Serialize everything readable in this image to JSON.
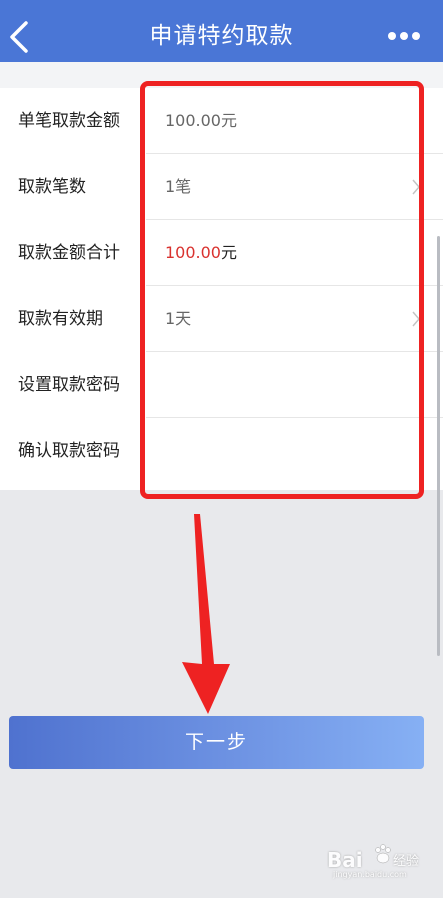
{
  "header": {
    "title": "申请特约取款",
    "back_icon": "chevron-left-icon",
    "more_icon": "more-horizontal-icon",
    "color": "#4a76d6"
  },
  "form": {
    "rows": [
      {
        "label": "单笔取款金额",
        "value": "100.00元"
      },
      {
        "label": "取款笔数",
        "value": "1笔",
        "has_chevron": true
      },
      {
        "label": "取款金额合计",
        "value_amount": "100.00",
        "value_unit": "元"
      },
      {
        "label": "取款有效期",
        "value": "1天",
        "has_chevron": true
      },
      {
        "label": "设置取款密码",
        "value": ""
      },
      {
        "label": "确认取款密码",
        "value": ""
      }
    ]
  },
  "next_button": {
    "label": "下一步"
  },
  "watermark": {
    "brand": "Bai",
    "suffix": "经验",
    "url": "jingyan.baidu.com"
  },
  "colors": {
    "accent": "#4a76d6",
    "highlight_red": "#ee2222",
    "amount_red": "#d9322f"
  }
}
